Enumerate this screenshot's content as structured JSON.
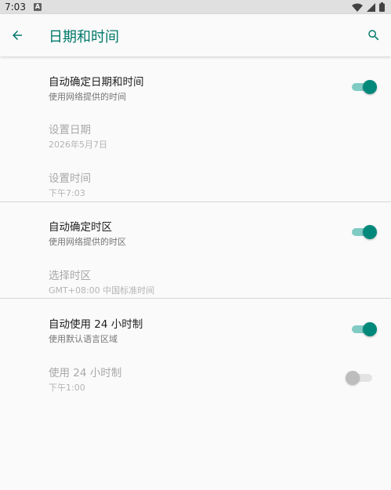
{
  "status_bar": {
    "time": "7:03",
    "notification_icon_letter": "A"
  },
  "app_bar": {
    "title": "日期和时间"
  },
  "preferences": [
    {
      "title": "自动确定日期和时间",
      "summary": "使用网络提供的时间",
      "enabled": true,
      "switch": "on"
    },
    {
      "title": "设置日期",
      "summary": "2026年5月7日",
      "enabled": false
    },
    {
      "title": "设置时间",
      "summary": "下午7:03",
      "enabled": false
    },
    {
      "title": "自动确定时区",
      "summary": "使用网络提供的时区",
      "enabled": true,
      "switch": "on"
    },
    {
      "title": "选择时区",
      "summary": "GMT+08:00 中国标准时间",
      "enabled": false
    },
    {
      "title": "自动使用 24 小时制",
      "summary": "使用默认语言区域",
      "enabled": true,
      "switch": "on"
    },
    {
      "title": "使用 24 小时制",
      "summary": "下午1:00",
      "enabled": false,
      "switch": "off"
    }
  ],
  "colors": {
    "accent": "#00796b",
    "switch_thumb_on": "#00897b",
    "switch_track_on": "#80cbc4"
  }
}
